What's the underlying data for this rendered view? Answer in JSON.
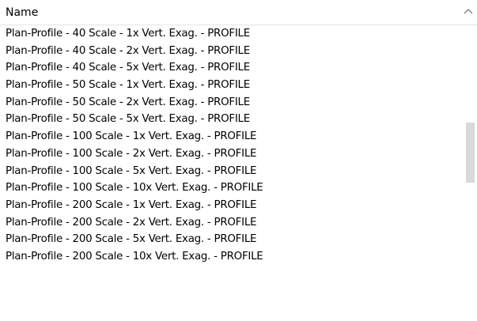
{
  "header": {
    "name_label": "Name"
  },
  "rows": [
    "Plan-Profile - 40 Scale - 1x Vert. Exag. - PROFILE",
    "Plan-Profile - 40 Scale - 2x Vert. Exag. - PROFILE",
    "Plan-Profile - 40 Scale - 5x Vert. Exag. - PROFILE",
    "Plan-Profile - 50 Scale - 1x Vert. Exag. - PROFILE",
    "Plan-Profile - 50 Scale - 2x Vert. Exag. - PROFILE",
    "Plan-Profile - 50 Scale - 5x Vert. Exag. - PROFILE",
    "Plan-Profile - 100 Scale - 1x Vert. Exag. - PROFILE",
    "Plan-Profile - 100 Scale - 2x Vert. Exag. - PROFILE",
    "Plan-Profile - 100 Scale - 5x Vert. Exag. - PROFILE",
    "Plan-Profile - 100 Scale - 10x Vert. Exag. - PROFILE",
    "Plan-Profile - 200 Scale - 1x Vert. Exag. - PROFILE",
    "Plan-Profile - 200 Scale - 2x Vert. Exag. - PROFILE",
    "Plan-Profile - 200 Scale - 5x Vert. Exag. - PROFILE",
    "Plan-Profile - 200 Scale - 10x Vert. Exag. - PROFILE"
  ],
  "icons": {
    "sort_indicator": "chevron-up-icon"
  }
}
